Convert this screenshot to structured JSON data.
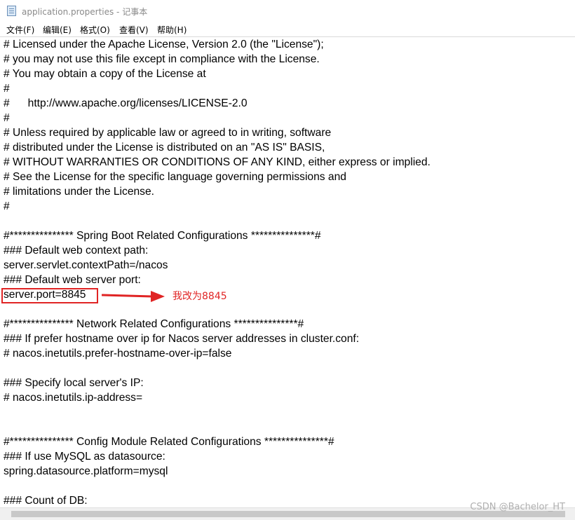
{
  "window": {
    "title": "application.properties - 记事本"
  },
  "menu": [
    {
      "label": "文件(F)"
    },
    {
      "label": "编辑(E)"
    },
    {
      "label": "格式(O)"
    },
    {
      "label": "查看(V)"
    },
    {
      "label": "帮助(H)"
    }
  ],
  "editor": {
    "lines": [
      "# Licensed under the Apache License, Version 2.0 (the \"License\");",
      "# you may not use this file except in compliance with the License.",
      "# You may obtain a copy of the License at",
      "#",
      "#      http://www.apache.org/licenses/LICENSE-2.0",
      "#",
      "# Unless required by applicable law or agreed to in writing, software",
      "# distributed under the License is distributed on an \"AS IS\" BASIS,",
      "# WITHOUT WARRANTIES OR CONDITIONS OF ANY KIND, either express or implied.",
      "# See the License for the specific language governing permissions and",
      "# limitations under the License.",
      "#",
      "",
      "#*************** Spring Boot Related Configurations ***************#",
      "### Default web context path:",
      "server.servlet.contextPath=/nacos",
      "### Default web server port:",
      "server.port=8845",
      "",
      "#*************** Network Related Configurations ***************#",
      "### If prefer hostname over ip for Nacos server addresses in cluster.conf:",
      "# nacos.inetutils.prefer-hostname-over-ip=false",
      "",
      "### Specify local server's IP:",
      "# nacos.inetutils.ip-address=",
      "",
      "",
      "#*************** Config Module Related Configurations ***************#",
      "### If use MySQL as datasource:",
      "spring.datasource.platform=mysql",
      "",
      "### Count of DB:"
    ]
  },
  "annotation": {
    "text": "我改为8845",
    "color": "#e02424"
  },
  "watermark": "CSDN @Bachelor_HT"
}
